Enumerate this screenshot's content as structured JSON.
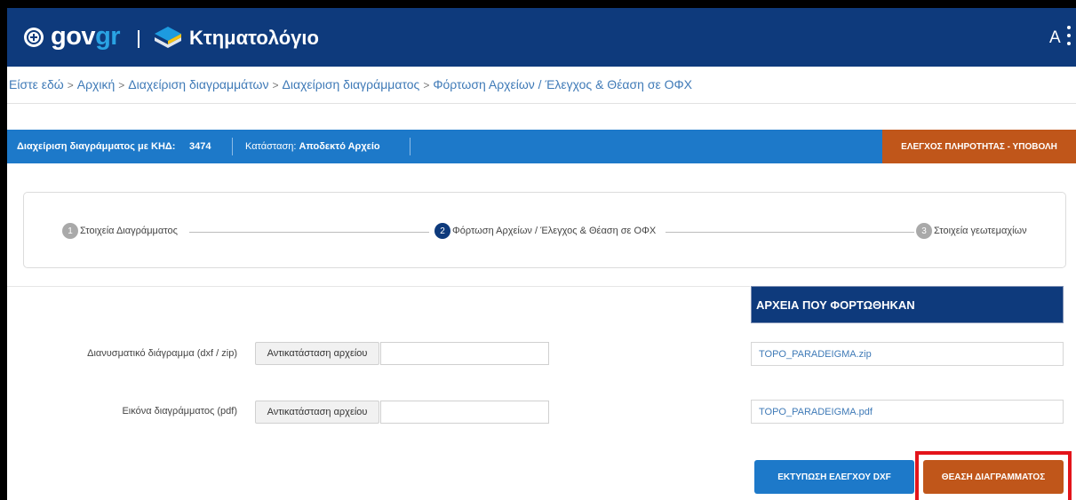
{
  "header": {
    "gov_part1": "gov",
    "gov_part2": "gr",
    "app_name": "Κτηματολόγιο",
    "avatar_initial": "A"
  },
  "breadcrumb": {
    "prefix": "Είστε εδώ",
    "items": [
      "Αρχική",
      "Διαχείριση διαγραμμάτων",
      "Διαχείριση διαγράμματος",
      "Φόρτωση Αρχείων / Έλεγχος & Θέαση σε ΟΦΧ"
    ]
  },
  "infobar": {
    "diagram_label": "Διαχείριση διαγράμματος με ΚΗΔ:",
    "khd_value": "3474",
    "status_label": "Κατάσταση:",
    "status_value": "Αποδεκτό Αρχείο",
    "submit_button": "ΕΛΕΓΧΟΣ ΠΛΗΡΟΤΗΤΑΣ - ΥΠΟΒΟΛΗ"
  },
  "stepper": {
    "steps": [
      {
        "number": "1",
        "label": "Στοιχεία Διαγράμματος"
      },
      {
        "number": "2",
        "label": "Φόρτωση Αρχείων / Έλεγχος & Θέαση σε ΟΦΧ"
      },
      {
        "number": "3",
        "label": "Στοιχεία γεωτεμαχίων"
      }
    ]
  },
  "uploaded": {
    "title": "ΑΡΧΕΙΑ ΠΟΥ ΦΟΡΤΩΘΗΚΑΝ",
    "files": [
      "TOPO_PARADEIGMA.zip",
      "TOPO_PARADEIGMA.pdf"
    ]
  },
  "form": {
    "rows": [
      {
        "label": "Διανυσματικό διάγραμμα (dxf / zip)",
        "button": "Αντικατάσταση αρχείου"
      },
      {
        "label": "Εικόνα διαγράμματος (pdf)",
        "button": "Αντικατάσταση αρχείου"
      }
    ]
  },
  "actions": {
    "print_button": "ΕΚΤΥΠΩΣΗ ΕΛΕΓΧΟΥ DXF",
    "view_button": "ΘΕΑΣΗ ΔΙΑΓΡΑΜΜΑΤΟΣ"
  },
  "colors": {
    "header_bg": "#0e3a7c",
    "infobar_bg": "#1d79c9",
    "accent_orange": "#c0561a",
    "highlight_red": "#e3141b"
  }
}
